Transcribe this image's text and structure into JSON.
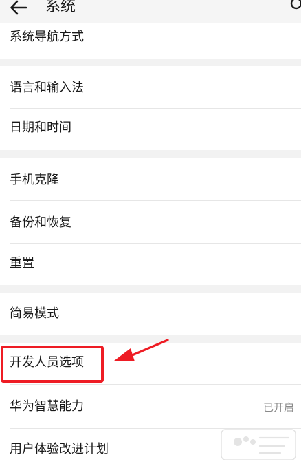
{
  "header": {
    "title": "系统"
  },
  "rows": {
    "nav": {
      "label": "系统导航方式"
    },
    "language": {
      "label": "语言和输入法"
    },
    "datetime": {
      "label": "日期和时间"
    },
    "clone": {
      "label": "手机克隆"
    },
    "backup": {
      "label": "备份和恢复"
    },
    "reset": {
      "label": "重置"
    },
    "simple": {
      "label": "简易模式"
    },
    "developer": {
      "label": "开发人员选项"
    },
    "huawei_ai": {
      "label": "华为智慧能力",
      "value": "已开启"
    },
    "ux_plan": {
      "label": "用户体验改进计划"
    }
  },
  "colors": {
    "accent_red": "#ee1c24",
    "background": "#f2f2f2",
    "card": "#ffffff"
  }
}
